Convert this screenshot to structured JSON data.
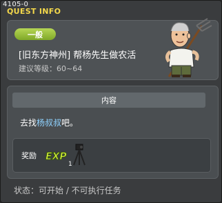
{
  "window": {
    "quest_id": "4105-0",
    "title": "QUEST INFO"
  },
  "quest": {
    "category": "一般",
    "name": "[旧东方神州] 帮杨先生做农活",
    "recommended_level": "建议等级：60~64"
  },
  "content": {
    "header": "内容",
    "desc_prefix": "去找",
    "npc_name": "杨叔叔",
    "desc_suffix": "吧。"
  },
  "reward": {
    "label": "奖励",
    "exp_text": "EXP",
    "item_count": "1"
  },
  "status": "状态：可开始 / 不可执行任务",
  "colors": {
    "title": "#f4d84b",
    "badge": "#8db52f",
    "npc_link": "#8fd2ff"
  },
  "icons": [
    "npc-farmer-portrait",
    "exp-icon",
    "tripod-item-icon"
  ]
}
